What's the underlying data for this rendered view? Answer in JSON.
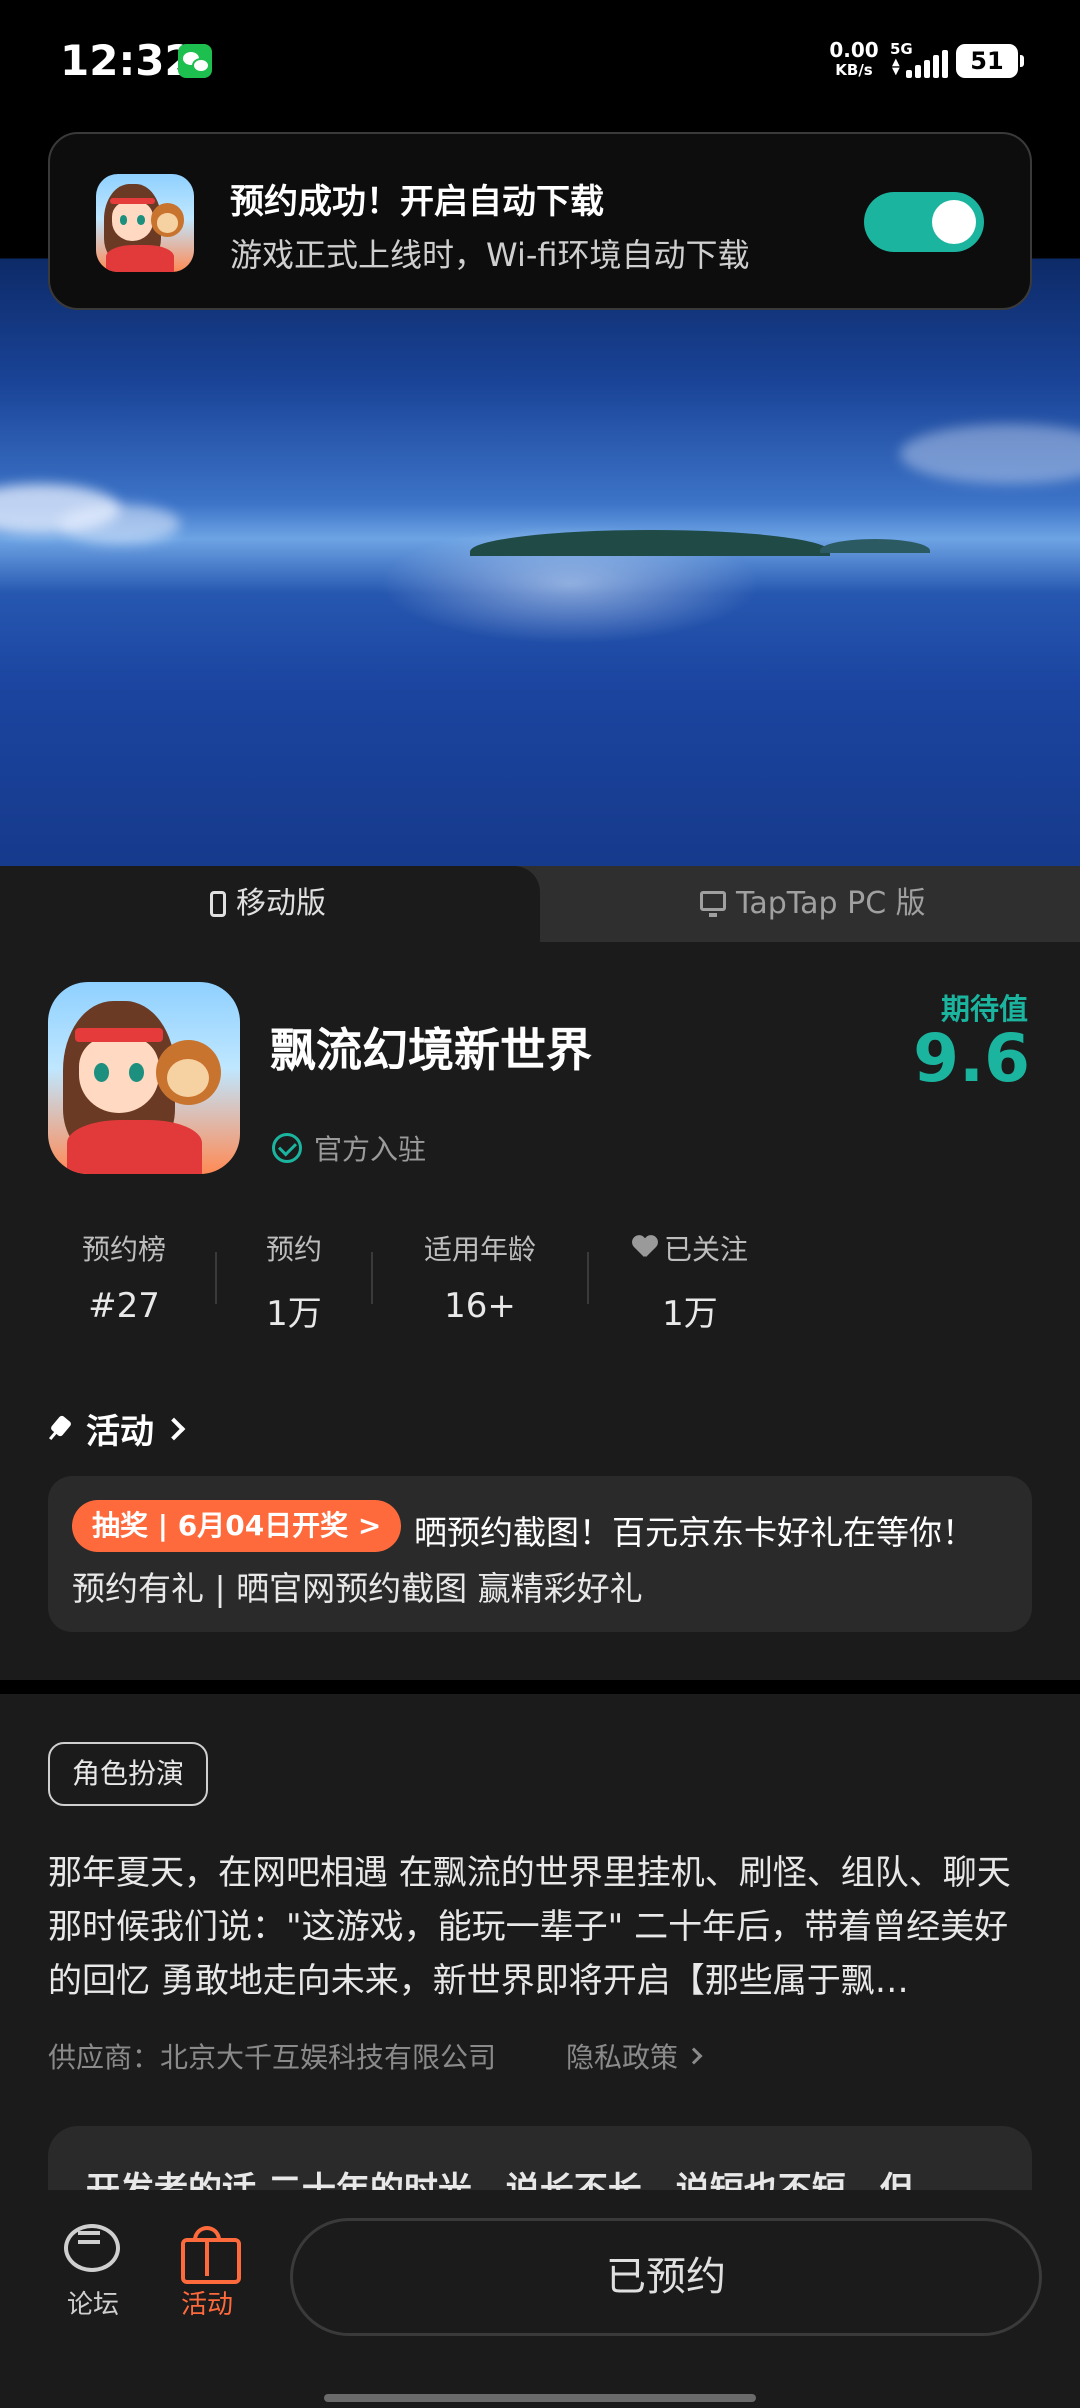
{
  "status_bar": {
    "time": "12:32",
    "net_speed_value": "0.00",
    "net_speed_unit": "KB/s",
    "network": "5G",
    "battery": "51",
    "icons": [
      "wechat-icon",
      "signal-icon",
      "battery-icon"
    ]
  },
  "notification": {
    "title": "预约成功！开启自动下载",
    "subtitle": "游戏正式上线时，Wi-fi环境自动下载",
    "toggle_on": true
  },
  "tabs": {
    "mobile": "移动版",
    "pc": "TapTap PC 版",
    "active": "mobile"
  },
  "game": {
    "title": "飘流幻境新世界",
    "official": "官方入驻",
    "expect_label": "期待值",
    "expect_score": "9.6"
  },
  "stats": [
    {
      "label": "预约榜",
      "value": "#27"
    },
    {
      "label": "预约",
      "value": "1万"
    },
    {
      "label": "适用年龄",
      "value": "16+"
    },
    {
      "label": "已关注",
      "value": "1万"
    }
  ],
  "activity": {
    "header": "活动",
    "badge": "抽奖 | 6月04日开奖 >",
    "line1": "晒预约截图！百元京东卡好礼在等你！",
    "line2": "预约有礼 | 晒官网预约截图 赢精彩好礼"
  },
  "tag": "角色扮演",
  "description": "那年夏天，在网吧相遇 在飘流的世界里挂机、刷怪、组队、聊天 那时候我们说：\"这游戏，能玩一辈子\" 二十年后，带着曾经美好的回忆 勇敢地走向未来，新世界即将开启【那些属于飘…",
  "supplier": "供应商：北京大千互娱科技有限公司",
  "privacy": "隐私政策",
  "developer_note": "开发者的话 二十年的时光，说长不长，说短也不短，但",
  "bottom_nav": {
    "forum": "论坛",
    "activity": "活动",
    "reserved_button": "已预约"
  },
  "colors": {
    "accent_teal": "#1bb49f",
    "accent_orange": "#ff6a3d",
    "background": "#1b1b1b"
  }
}
